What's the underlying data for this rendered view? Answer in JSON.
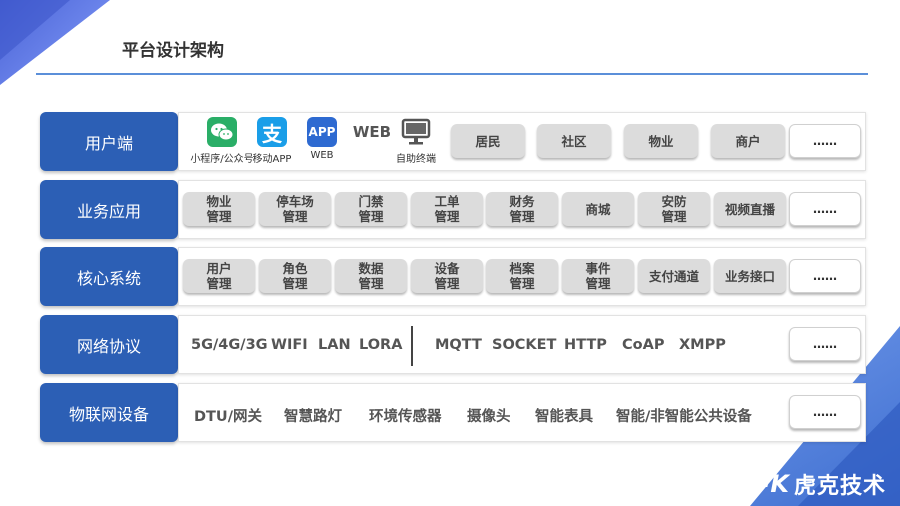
{
  "page_title": "平台设计架构",
  "rows": [
    {
      "label": "用户端",
      "apps": [
        {
          "icon": "wechat-icon",
          "caption": "小程序/公众号"
        },
        {
          "icon": "alipay-icon",
          "caption": "移动APP",
          "text": "支"
        },
        {
          "icon": "app-icon",
          "caption": "WEB",
          "text": "APP"
        },
        {
          "icon": "web-text-icon",
          "caption": "自助终端",
          "text": "WEB"
        }
      ],
      "chips": [
        "居民",
        "社区",
        "物业",
        "商户",
        "……"
      ]
    },
    {
      "label": "业务应用",
      "chips": [
        "物业\n管理",
        "停车场\n管理",
        "门禁\n管理",
        "工单\n管理",
        "财务\n管理",
        "商城",
        "安防\n管理",
        "视频直播",
        "……"
      ]
    },
    {
      "label": "核心系统",
      "chips": [
        "用户\n管理",
        "角色\n管理",
        "数据\n管理",
        "设备\n管理",
        "档案\n管理",
        "事件\n管理",
        "支付通道",
        "业务接口",
        "……"
      ]
    },
    {
      "label": "网络协议",
      "items_left": [
        "5G/4G/3G",
        "WIFI",
        "LAN",
        "LORA"
      ],
      "items_right": [
        "MQTT",
        "SOCKET",
        "HTTP",
        "CoAP",
        "XMPP"
      ],
      "more": "……"
    },
    {
      "label": "物联网设备",
      "items": [
        "DTU/网关",
        "智慧路灯",
        "环境传感器",
        "摄像头",
        "智能表具",
        "智能/非智能公共设备"
      ],
      "more": "……"
    }
  ],
  "logo": {
    "mark": "I-K",
    "text": "虎克技术"
  },
  "colors": {
    "accent": "#2c5fb5",
    "rule": "#5b8fd9",
    "chip": "#dcdcdc"
  }
}
